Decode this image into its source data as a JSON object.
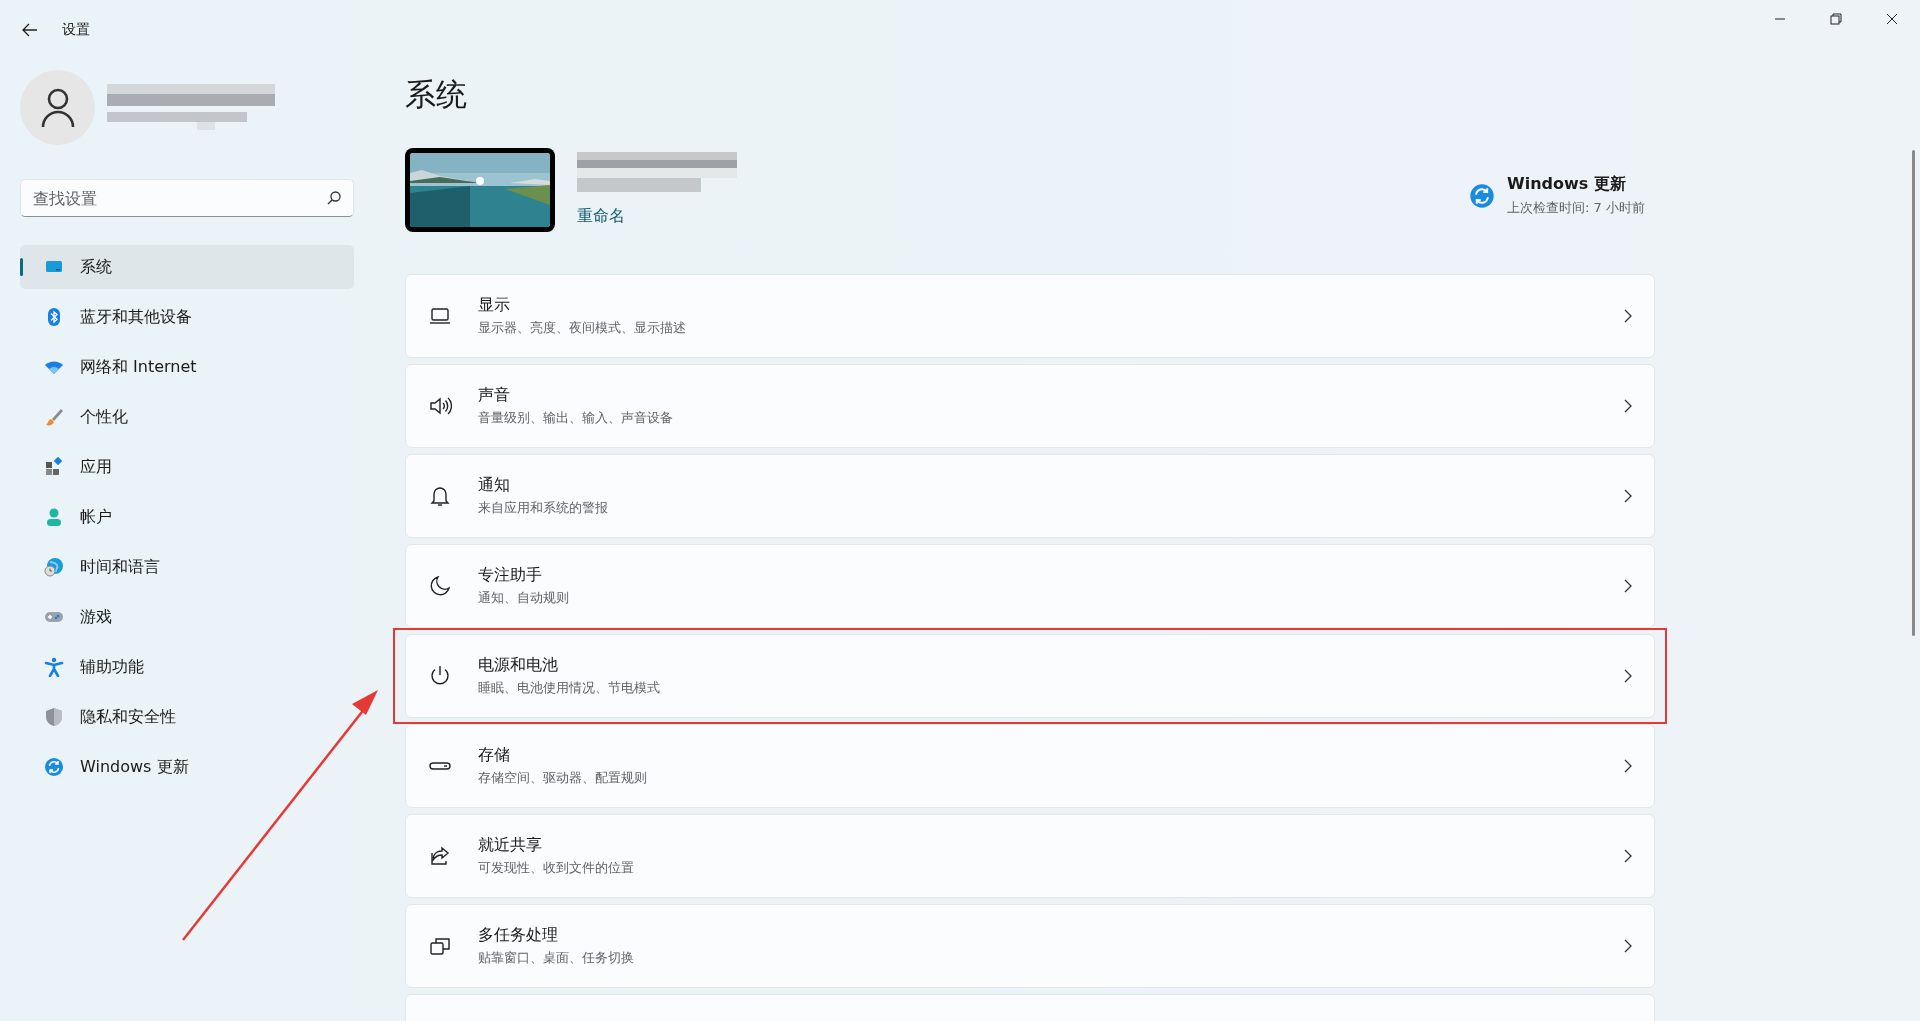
{
  "window": {
    "title": "设置"
  },
  "search": {
    "placeholder": "查找设置"
  },
  "nav": [
    {
      "label": "系统",
      "selected": true
    },
    {
      "label": "蓝牙和其他设备",
      "selected": false
    },
    {
      "label": "网络和 Internet",
      "selected": false
    },
    {
      "label": "个性化",
      "selected": false
    },
    {
      "label": "应用",
      "selected": false
    },
    {
      "label": "帐户",
      "selected": false
    },
    {
      "label": "时间和语言",
      "selected": false
    },
    {
      "label": "游戏",
      "selected": false
    },
    {
      "label": "辅助功能",
      "selected": false
    },
    {
      "label": "隐私和安全性",
      "selected": false
    },
    {
      "label": "Windows 更新",
      "selected": false
    }
  ],
  "page_title": "系统",
  "device": {
    "rename_link": "重命名"
  },
  "update": {
    "title": "Windows 更新",
    "subtitle": "上次检查时间: 7 小时前"
  },
  "settings": [
    {
      "title": "显示",
      "description": "显示器、亮度、夜间模式、显示描述",
      "highlighted": false
    },
    {
      "title": "声音",
      "description": "音量级别、输出、输入、声音设备",
      "highlighted": false
    },
    {
      "title": "通知",
      "description": "来自应用和系统的警报",
      "highlighted": false
    },
    {
      "title": "专注助手",
      "description": "通知、自动规则",
      "highlighted": false
    },
    {
      "title": "电源和电池",
      "description": "睡眠、电池使用情况、节电模式",
      "highlighted": true
    },
    {
      "title": "存储",
      "description": "存储空间、驱动器、配置规则",
      "highlighted": false
    },
    {
      "title": "就近共享",
      "description": "可发现性、收到文件的位置",
      "highlighted": false
    },
    {
      "title": "多任务处理",
      "description": "贴靠窗口、桌面、任务切换",
      "highlighted": false
    }
  ]
}
